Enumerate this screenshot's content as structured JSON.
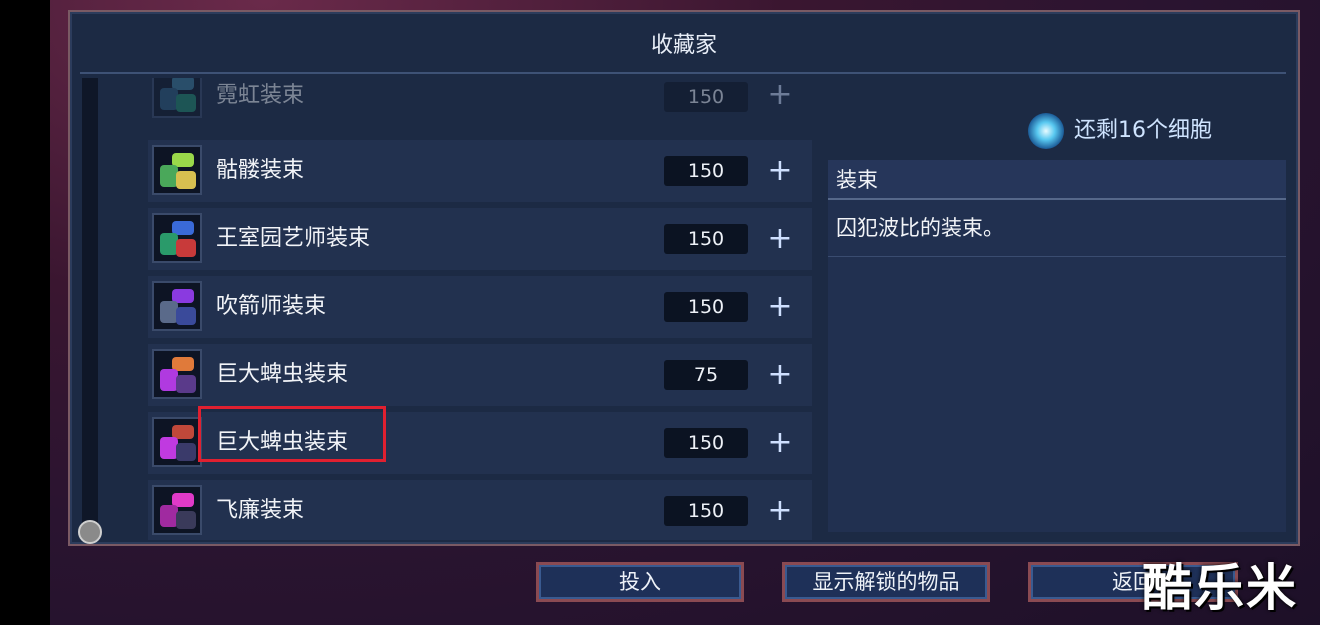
{
  "title": "收藏家",
  "cells_remaining": "还剩16个细胞",
  "list": [
    {
      "name": "霓虹装束",
      "price": "150",
      "dim": true,
      "colors": [
        "#3a7a9a",
        "#2a5a7a",
        "#1f8a6a"
      ]
    },
    {
      "name": "骷髅装束",
      "price": "150",
      "dim": false,
      "colors": [
        "#9ad84a",
        "#4aa85a",
        "#d8c050"
      ]
    },
    {
      "name": "王室园艺师装束",
      "price": "150",
      "dim": false,
      "colors": [
        "#3a6ad8",
        "#2a9a6a",
        "#c83a3a"
      ]
    },
    {
      "name": "吹箭师装束",
      "price": "150",
      "dim": false,
      "colors": [
        "#8a3ae0",
        "#5a6a8a",
        "#3a4a9a"
      ]
    },
    {
      "name": "巨大蜱虫装束",
      "price": "75",
      "dim": false,
      "colors": [
        "#e07a3a",
        "#b03ae0",
        "#5a3a8a"
      ]
    },
    {
      "name": "巨大蜱虫装束",
      "price": "150",
      "dim": false,
      "colors": [
        "#c0483a",
        "#c03ae0",
        "#3a3a6a"
      ]
    },
    {
      "name": "飞廉装束",
      "price": "150",
      "dim": false,
      "colors": [
        "#e03ac8",
        "#a02aa0",
        "#3a3a5a"
      ]
    }
  ],
  "detail": {
    "heading": "装束",
    "description": "囚犯波比的装束。"
  },
  "buttons": {
    "invest": "投入",
    "show_unlocked": "显示解锁的物品",
    "back": "返回"
  },
  "watermark": "酷乐米"
}
